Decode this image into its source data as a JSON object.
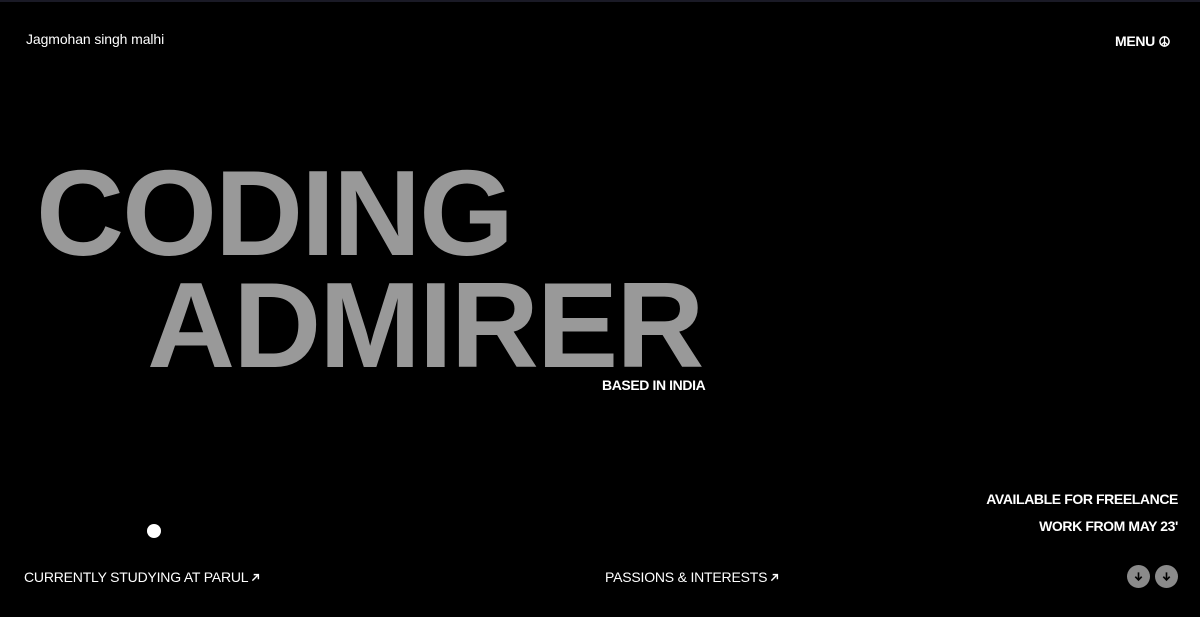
{
  "header": {
    "brand": "Jagmohan singh malhi",
    "menu_label": "MENU"
  },
  "hero": {
    "line1": "CODING",
    "line2": "ADMIRER",
    "location": "BASED IN INDIA"
  },
  "availability": {
    "line1": "AVAILABLE FOR FREELANCE",
    "line2": "WORK FROM MAY 23'"
  },
  "footer": {
    "link1": "CURRENTLY STUDYING AT PARUL",
    "link2": "PASSIONS & INTERESTS"
  },
  "icons": {
    "menu": "peace-icon",
    "link": "arrow-up-right-icon",
    "scroll": "arrow-down-icon"
  },
  "colors": {
    "background": "#000000",
    "hero_text": "#999999",
    "text": "#ffffff",
    "scroll_button": "#8a8a8a"
  }
}
